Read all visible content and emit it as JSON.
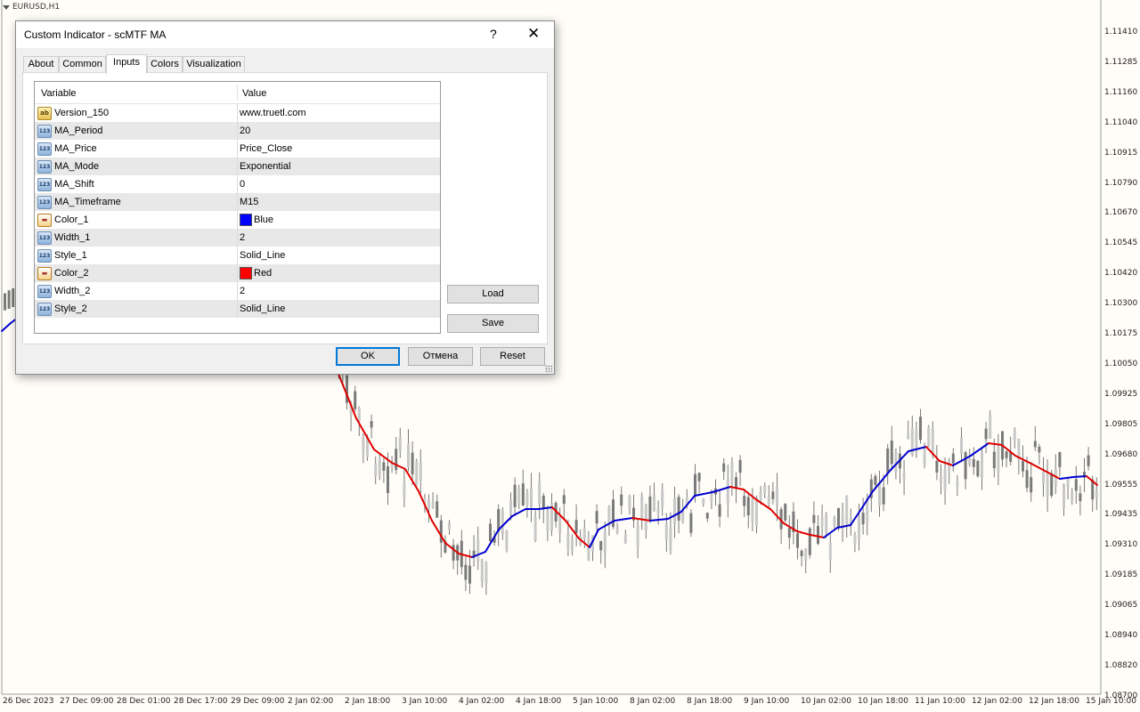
{
  "chart": {
    "symbol": "EURUSD,H1",
    "price_ticks": [
      "1.11410",
      "1.11285",
      "1.11160",
      "1.11040",
      "1.10915",
      "1.10790",
      "1.10670",
      "1.10545",
      "1.10420",
      "1.10300",
      "1.10175",
      "1.10050",
      "1.09925",
      "1.09805",
      "1.09680",
      "1.09555",
      "1.09435",
      "1.09310",
      "1.09185",
      "1.09065",
      "1.08940",
      "1.08820",
      "1.08700"
    ],
    "time_ticks": [
      "26 Dec 2023",
      "27 Dec 09:00",
      "28 Dec 01:00",
      "28 Dec 17:00",
      "29 Dec 09:00",
      "2 Jan 02:00",
      "2 Jan 18:00",
      "3 Jan 10:00",
      "4 Jan 02:00",
      "4 Jan 18:00",
      "5 Jan 10:00",
      "8 Jan 02:00",
      "8 Jan 18:00",
      "9 Jan 10:00",
      "10 Jan 02:00",
      "10 Jan 18:00",
      "11 Jan 10:00",
      "12 Jan 02:00",
      "12 Jan 18:00",
      "15 Jan 10:00"
    ],
    "colors": {
      "ma_up": "#0000d0",
      "ma_down": "#e00000",
      "candle": "#7a7a7a"
    }
  },
  "dialog": {
    "title": "Custom Indicator - scMTF MA",
    "help_label": "?",
    "close_label": "✕",
    "tabs": [
      {
        "label": "About"
      },
      {
        "label": "Common"
      },
      {
        "label": "Inputs"
      },
      {
        "label": "Colors"
      },
      {
        "label": "Visualization"
      }
    ],
    "active_tab": "Inputs",
    "grid": {
      "header_variable": "Variable",
      "header_value": "Value",
      "rows": [
        {
          "icon": "string-icon",
          "variable": "Version_150",
          "value": "www.truetl.com"
        },
        {
          "icon": "number-icon",
          "variable": "MA_Period",
          "value": "20"
        },
        {
          "icon": "number-icon",
          "variable": "MA_Price",
          "value": "Price_Close"
        },
        {
          "icon": "number-icon",
          "variable": "MA_Mode",
          "value": "Exponential"
        },
        {
          "icon": "number-icon",
          "variable": "MA_Shift",
          "value": "0"
        },
        {
          "icon": "number-icon",
          "variable": "MA_Timeframe",
          "value": "M15"
        },
        {
          "icon": "color-icon",
          "variable": "Color_1",
          "value": "Blue",
          "swatch": "#0000ff"
        },
        {
          "icon": "number-icon",
          "variable": "Width_1",
          "value": "2"
        },
        {
          "icon": "number-icon",
          "variable": "Style_1",
          "value": "Solid_Line"
        },
        {
          "icon": "color-icon",
          "variable": "Color_2",
          "value": "Red",
          "swatch": "#ff0000"
        },
        {
          "icon": "number-icon",
          "variable": "Width_2",
          "value": "2"
        },
        {
          "icon": "number-icon",
          "variable": "Style_2",
          "value": "Solid_Line"
        }
      ]
    },
    "buttons": {
      "load": "Load",
      "save": "Save",
      "ok": "OK",
      "cancel": "Отмена",
      "reset": "Reset"
    }
  }
}
